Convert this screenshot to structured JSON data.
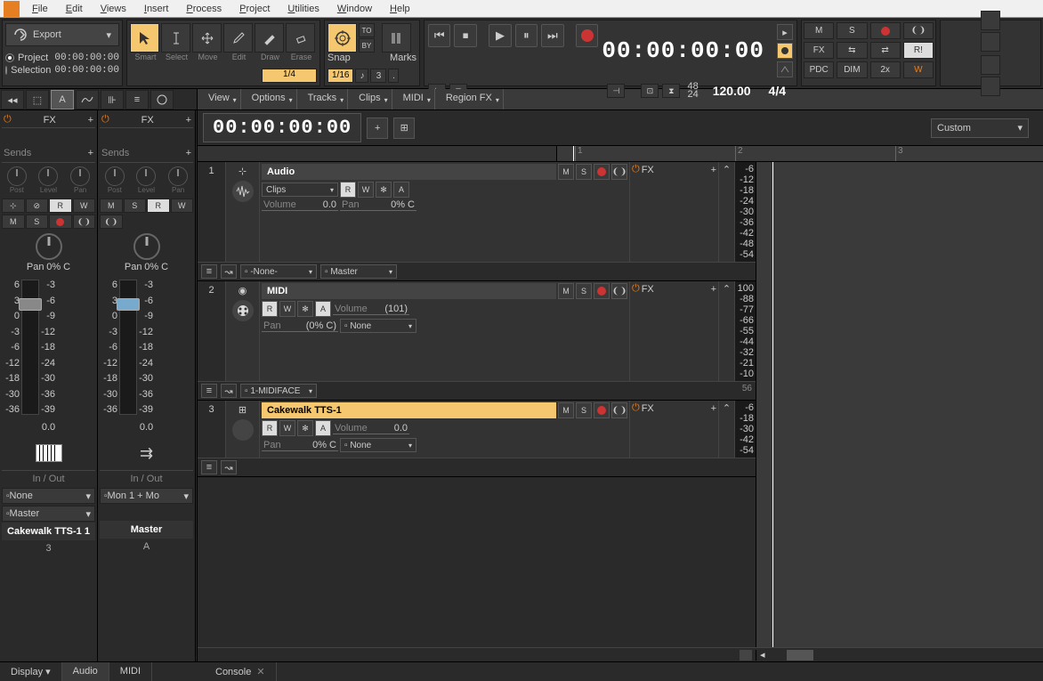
{
  "menu": [
    "File",
    "Edit",
    "Views",
    "Insert",
    "Process",
    "Project",
    "Utilities",
    "Window",
    "Help"
  ],
  "export": {
    "label": "Export",
    "project": "Project",
    "selection": "Selection",
    "proj_time": "00:00:00:00",
    "sel_time": "00:00:00:00"
  },
  "tools": {
    "labels": [
      "Smart",
      "Select",
      "Move",
      "Edit",
      "Draw",
      "Erase"
    ],
    "value": "1/4"
  },
  "snap": {
    "label": "Snap",
    "marks": "Marks",
    "to": "TO",
    "by": "BY",
    "value": "1/16",
    "value2": "3"
  },
  "transport": {
    "timecode": "00:00:00:00",
    "sr": "48",
    "bits": "24",
    "tempo": "120.00",
    "meter": "4/4"
  },
  "mix": {
    "row1": [
      "M",
      "S",
      "●",
      "❨❩"
    ],
    "row2": [
      "FX",
      "⇆",
      "⇄",
      "R!"
    ],
    "row3": [
      "PDC",
      "DIM",
      "2x",
      "W"
    ]
  },
  "subbar": {
    "menus": [
      "View",
      "Options",
      "Tracks",
      "Clips",
      "MIDI",
      "Region FX"
    ]
  },
  "tracks_header": {
    "timecode": "00:00:00:00",
    "mode": "Custom"
  },
  "ruler": {
    "marks": [
      {
        "pos": 20,
        "label": "1"
      },
      {
        "pos": 200,
        "label": "2"
      },
      {
        "pos": 380,
        "label": "3"
      }
    ]
  },
  "inspector": {
    "col1": {
      "fx": "FX",
      "sends": "Sends",
      "knobs": [
        "Post",
        "Level",
        "Pan"
      ],
      "btn_row1": [
        "⊹",
        "⊘",
        "R",
        "W"
      ],
      "btn_row2": [
        "M",
        "S",
        "●",
        "❨❩"
      ],
      "pan_label": "Pan",
      "pan_val": "0% C",
      "scale_l": [
        "6",
        "3",
        "0",
        "-3",
        "-6",
        "-12",
        "-18",
        "-30",
        "-36"
      ],
      "scale_r": [
        "-3",
        "-6",
        "-9",
        "-12",
        "-18",
        "-24",
        "-30",
        "-36",
        "-39"
      ],
      "level": "0.0",
      "io": "In / Out",
      "in": "None",
      "out": "Master",
      "name": "Cakewalk TTS-1 1",
      "ch": "3"
    },
    "col2": {
      "fx": "FX",
      "sends": "Sends",
      "knobs": [
        "Post",
        "Level",
        "Pan"
      ],
      "btn_row1": [
        "M",
        "S",
        "R",
        "W"
      ],
      "btn_row2": [
        "❨❩"
      ],
      "pan_label": "Pan",
      "pan_val": "0% C",
      "scale_l": [
        "6",
        "3",
        "0",
        "-3",
        "-6",
        "-12",
        "-18",
        "-30",
        "-36"
      ],
      "scale_r": [
        "-3",
        "-6",
        "-9",
        "-12",
        "-18",
        "-24",
        "-30",
        "-36",
        "-39"
      ],
      "level": "0.0",
      "io": "In / Out",
      "in": "Mon 1 + Mo",
      "out": "",
      "name": "Master",
      "ch": "A"
    }
  },
  "tracks": [
    {
      "num": "1",
      "name": "Audio",
      "highlighted": false,
      "type": "audio",
      "clips_dd": "Clips",
      "vol": "0.0",
      "pan": "0% C",
      "input": "-None-",
      "output": "Master",
      "btns": [
        "M",
        "S",
        "●",
        "❨❩"
      ],
      "btns2": [
        "R",
        "W",
        "✻",
        "A"
      ],
      "fx": "FX",
      "meter": [
        "-6",
        "-12",
        "-18",
        "-24",
        "-30",
        "-36",
        "-42",
        "-48",
        "-54"
      ]
    },
    {
      "num": "2",
      "name": "MIDI",
      "highlighted": false,
      "type": "midi",
      "vol": "(101)",
      "pan": "(0% C)",
      "input": "1-MIDIFACE",
      "btns": [
        "M",
        "S",
        "●",
        "❨❩"
      ],
      "btns2": [
        "R",
        "W",
        "✻",
        "A"
      ],
      "fx": "FX",
      "out": "None",
      "meter": [
        "100",
        "-88",
        "-77",
        "-66",
        "-55",
        "-44",
        "-32",
        "-21",
        "-10"
      ]
    },
    {
      "num": "3",
      "name": "Cakewalk TTS-1",
      "highlighted": true,
      "type": "synth",
      "vol": "0.0",
      "pan": "0% C",
      "btns": [
        "M",
        "S",
        "●",
        "❨❩"
      ],
      "btns2": [
        "R",
        "W",
        "✻",
        "A"
      ],
      "fx": "FX",
      "out": "None",
      "meter": [
        "-6",
        "-18",
        "-30",
        "-42",
        "-54"
      ]
    }
  ],
  "bottom": {
    "left": [
      "Display",
      "Audio",
      "MIDI"
    ],
    "right": [
      "Console"
    ]
  },
  "vol_label": "Volume",
  "pan_label": "Pan"
}
